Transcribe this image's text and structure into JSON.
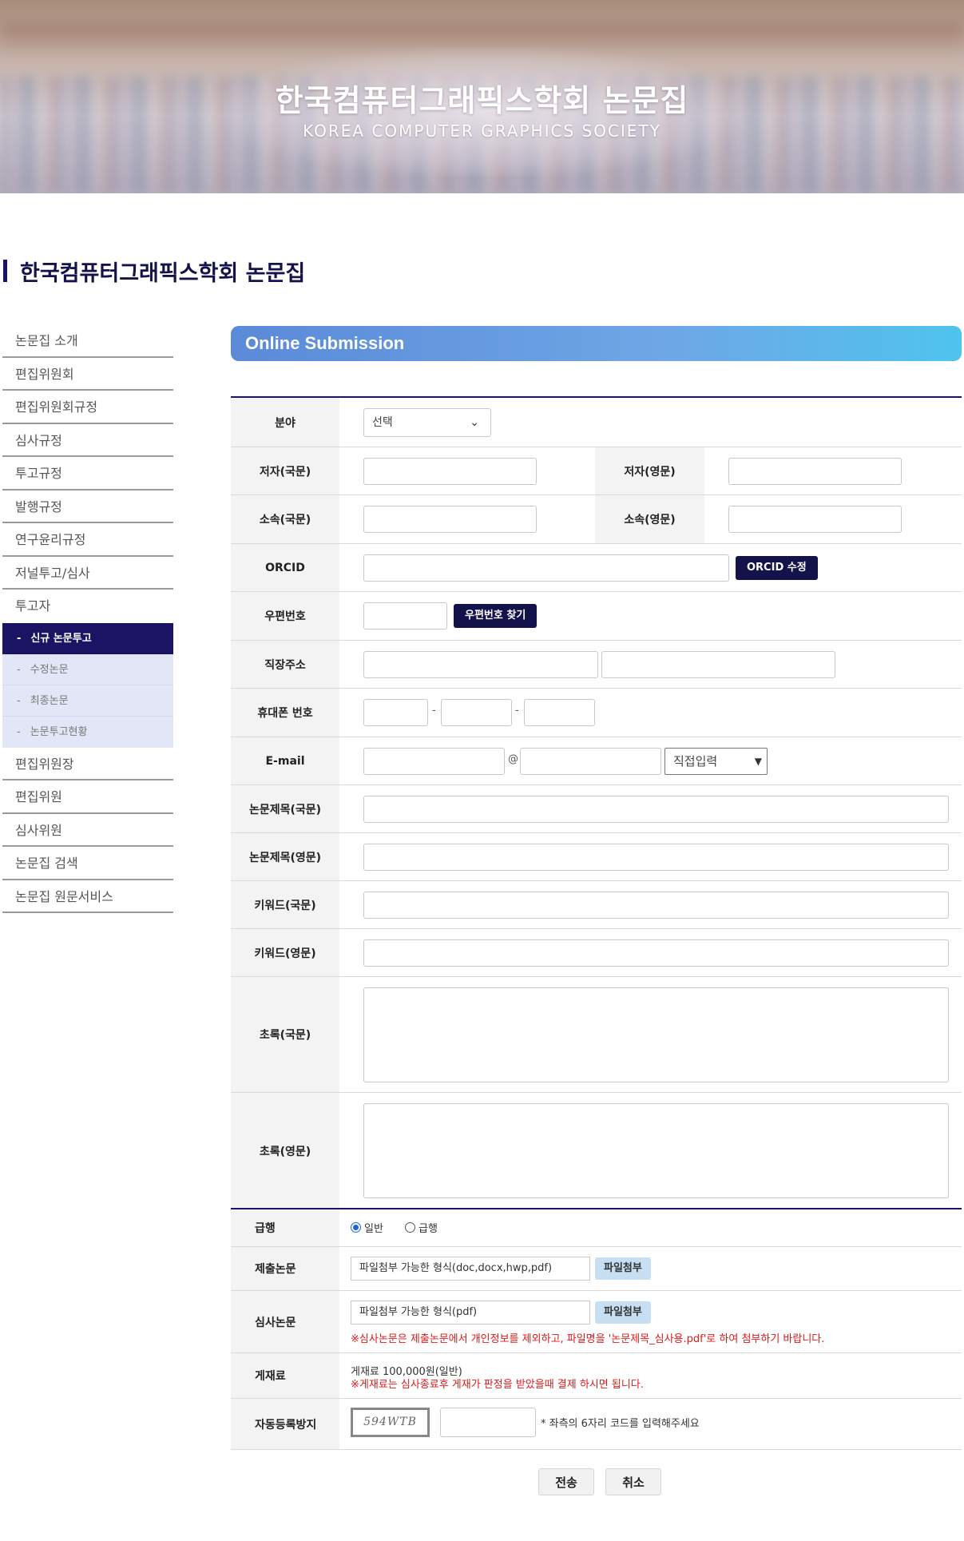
{
  "banner": {
    "title": "한국컴퓨터그래픽스학회 논문집",
    "subtitle": "KOREA COMPUTER GRAPHICS SOCIETY"
  },
  "page_title": "한국컴퓨터그래픽스학회 논문집",
  "sidebar": {
    "items_top": [
      "논문집 소개",
      "편집위원회",
      "편집위원회규정",
      "심사규정",
      "투고규정",
      "발행규정",
      "연구윤리규정",
      "저널투고/심사",
      "투고자"
    ],
    "subitems": [
      "신규 논문투고",
      "수정논문",
      "최종논문",
      "논문투고현황"
    ],
    "items_bottom": [
      "편집위원장",
      "편집위원",
      "심사위원",
      "논문집 검색",
      "논문집 원문서비스"
    ],
    "sub_dash": "-"
  },
  "section_title": "Online Submission",
  "form": {
    "field": {
      "label": "분야",
      "select_value": "선택"
    },
    "author_kr": "저자(국문)",
    "author_en": "저자(영문)",
    "affil_kr": "소속(국문)",
    "affil_en": "소속(영문)",
    "orcid": {
      "label": "ORCID",
      "button": "ORCID 수정"
    },
    "zipcode": {
      "label": "우편번호",
      "button": "우편번호 찾기"
    },
    "address": "직장주소",
    "phone": {
      "label": "휴대폰 번호",
      "sep": "-"
    },
    "email": {
      "label": "E-mail",
      "at": "@",
      "domain_select": "직접입력"
    },
    "title_kr": "논문제목(국문)",
    "title_en": "논문제목(영문)",
    "keyword_kr": "키워드(국문)",
    "keyword_en": "키워드(영문)",
    "abstract_kr": "초록(국문)",
    "abstract_en": "초록(영문)"
  },
  "form2": {
    "urgent": {
      "label": "급행",
      "option_normal": "일반",
      "option_urgent": "급행",
      "selected": "일반"
    },
    "submit_paper": {
      "label": "제출논문",
      "file_hint": "파일첨부 가능한 형식(doc,docx,hwp,pdf)",
      "button": "파일첨부"
    },
    "review_paper": {
      "label": "심사논문",
      "file_hint": "파일첨부 가능한 형식(pdf)",
      "button": "파일첨부",
      "note": "※심사논문은 제출논문에서 개인정보를 제외하고, 파일명을 '논문제목_심사용.pdf'로 하여 첨부하기 바랍니다."
    },
    "fee": {
      "label": "게재료",
      "amount": "게재료 100,000원(일반)",
      "note": "※게재료는 심사종료후 게재가 판정을 받았을때 결제 하시면 됩니다."
    },
    "captcha": {
      "label": "자동등록방지",
      "code": "594WTB",
      "note": "* 좌측의 6자리 코드를 입력해주세요"
    }
  },
  "buttons": {
    "submit": "전송",
    "cancel": "취소"
  },
  "colors": {
    "navy": "#1b1464",
    "header_gradient_start": "#5b8ad8",
    "header_gradient_end": "#4fc4ec",
    "warning": "#e01a1a"
  }
}
